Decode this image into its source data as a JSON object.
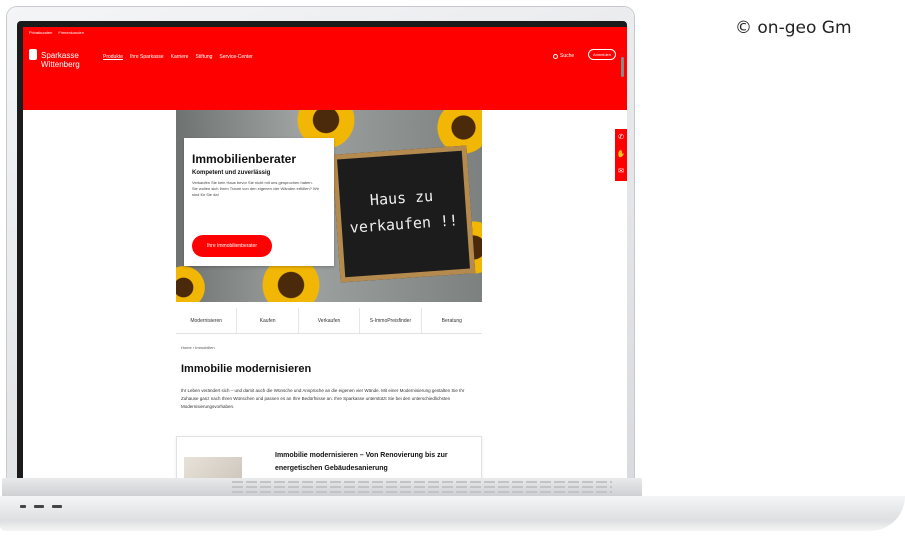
{
  "copyright": "© on-geo Gm",
  "site": {
    "topbar": [
      "Privatkunden",
      "Firmenkunden"
    ],
    "brand": {
      "line1": "Sparkasse",
      "line2": "Wittenberg"
    },
    "nav": [
      {
        "label": "Produkte",
        "active": true
      },
      {
        "label": "Ihre Sparkasse",
        "active": false
      },
      {
        "label": "Karriere",
        "active": false
      },
      {
        "label": "Stiftung",
        "active": false
      },
      {
        "label": "Service-Center",
        "active": false
      }
    ],
    "search_label": "Suche",
    "login_label": "Anmelden",
    "hero": {
      "title": "Immobilienberater",
      "subtitle": "Kompetent und zuverlässig",
      "desc_line1": "Verkaufen Sie kein Haus bevor Sie nicht mit uns gesprochen haben.",
      "desc_line2": "Sie wollen sich Ihren Traum von den eigenen vier Wänden erfüllen? Wir sind für Sie da!",
      "button": "Ihre Immobilienberater",
      "board_line1": "Haus zu",
      "board_line2": "verkaufen !!"
    },
    "side_icons": [
      "phone-icon",
      "hand-icon",
      "mail-icon"
    ],
    "tabs": [
      "Modernisieren",
      "Kaufen",
      "Verkaufen",
      "S-ImmoPreisfinder",
      "Beratung"
    ],
    "breadcrumb": "Home › Immobilien",
    "page_title": "Immobilie modernisieren",
    "intro": "Ihr Leben verändert sich – und damit auch die Wünsche und Ansprüche an die eigenen vier Wände. Mit einer Modernisierung gestalten Sie Ihr Zuhause ganz nach Ihren Wünschen und passen es an Ihre Bedürfnisse an. Ihre Sparkasse unterstützt Sie bei den unterschiedlichsten Modernisierungsvorhaben.",
    "article": {
      "title": "Immobilie modernisieren – Von Renovierung bis zur energetischen Gebäudesanierung"
    }
  },
  "colors": {
    "brand_red": "#ff0000"
  }
}
